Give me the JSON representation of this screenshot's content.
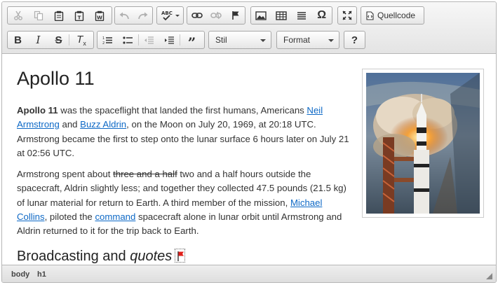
{
  "toolbar": {
    "source_label": "Quellcode",
    "styles_combo": "Stil",
    "format_combo": "Format",
    "help_label": "?"
  },
  "content": {
    "title": "Apollo 11",
    "p1": {
      "bold": "Apollo 11",
      "t1": " was the spaceflight that landed the first humans, Americans ",
      "link1": "Neil Armstrong",
      "t2": " and ",
      "link2": "Buzz Aldrin",
      "t3": ", on the Moon on July 20, 1969, at 20:18 UTC. Armstrong became the first to step onto the lunar surface 6 hours later on July 21 at 02:56 UTC."
    },
    "p2": {
      "t1": "Armstrong spent about ",
      "strike": "three and a half",
      "t2": " two and a half hours outside the spacecraft, Aldrin slightly less; and together they collected 47.5 pounds (21.5 kg) of lunar material for return to Earth. A third member of the mission, ",
      "link1": "Michael Collins",
      "t3": ", piloted the ",
      "link2": "command",
      "t4": " spacecraft alone in lunar orbit until Armstrong and Aldrin returned to it for the trip back to Earth."
    },
    "h2_plain": "Broadcasting and ",
    "h2_italic": "quotes"
  },
  "statusbar": {
    "path": [
      "body",
      "h1"
    ]
  },
  "colors": {
    "link": "#0e69c6",
    "flag": "#e0201b"
  }
}
